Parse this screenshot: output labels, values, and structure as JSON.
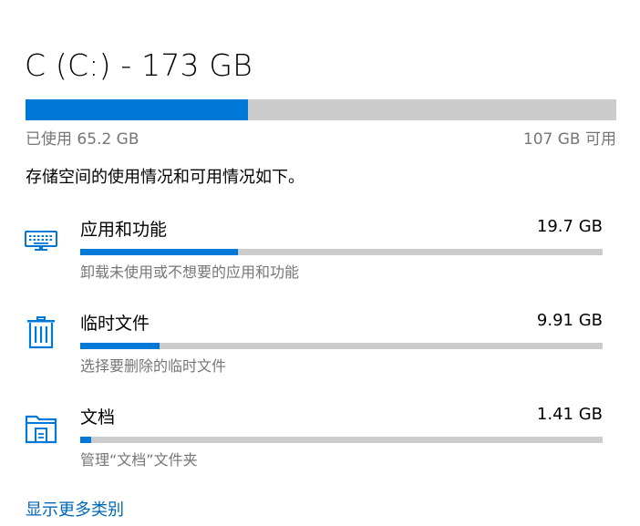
{
  "drive": {
    "title": "C (C:) - 173 GB",
    "used_label": "已使用 65.2 GB",
    "free_label": "107 GB 可用",
    "used_fraction": 0.377
  },
  "summary_text": "存储空间的使用情况和可用情况如下。",
  "categories": [
    {
      "name": "应用和功能",
      "size": "19.7 GB",
      "description": "卸载未使用或不想要的应用和功能",
      "icon": "keyboard-icon",
      "fraction": 0.302
    },
    {
      "name": "临时文件",
      "size": "9.91 GB",
      "description": "选择要删除的临时文件",
      "icon": "trash-icon",
      "fraction": 0.152
    },
    {
      "name": "文档",
      "size": "1.41 GB",
      "description": "管理“文档”文件夹",
      "icon": "folder-icon",
      "fraction": 0.021
    }
  ],
  "show_more_label": "显示更多类别",
  "colors": {
    "accent": "#0078d7",
    "bar_track": "#cccccc",
    "secondary_text": "#767676",
    "link": "#0067b8"
  }
}
